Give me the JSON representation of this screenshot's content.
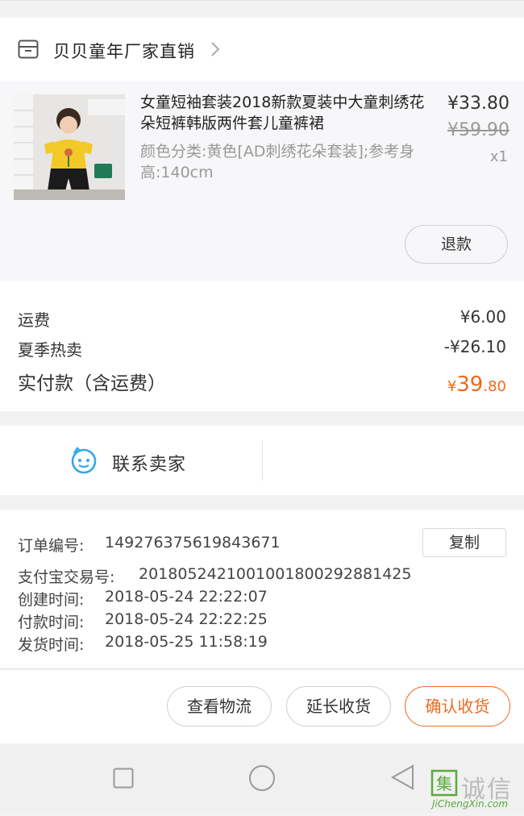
{
  "shop": {
    "name": "贝贝童年厂家直销"
  },
  "item": {
    "title": "女童短袖套装2018新款夏装中大童刺绣花朵短裤韩版两件套儿童裤裙",
    "sku": "颜色分类:黄色[AD刺绣花朵套装];参考身高:140cm",
    "price": "¥33.80",
    "original_price": "¥59.90",
    "quantity": "x1",
    "refund_label": "退款"
  },
  "fees": {
    "shipping_label": "运费",
    "shipping_value": "¥6.00",
    "promo_label": "夏季热卖",
    "promo_value": "-¥26.10",
    "total_label": "实付款（含运费）",
    "total_currency": "¥",
    "total_int": "39",
    "total_dec": ".80"
  },
  "contact": {
    "label": "联系卖家"
  },
  "order_info": {
    "order_no_label": "订单编号:",
    "order_no": "149276375619843671",
    "copy_label": "复制",
    "alipay_label": "支付宝交易号:",
    "alipay_no": "2018052421001001800292881425",
    "created_label": "创建时间:",
    "created": "2018-05-24 22:22:07",
    "paid_label": "付款时间:",
    "paid": "2018-05-24 22:22:25",
    "shipped_label": "发货时间:",
    "shipped": "2018-05-25 11:58:19"
  },
  "actions": {
    "logistics": "查看物流",
    "extend": "延长收货",
    "confirm": "确认收货"
  },
  "watermark": {
    "brand": "诚信",
    "url": "JiChengXin.com"
  },
  "colors": {
    "accent": "#ee6a20",
    "contact_icon": "#34a8e6"
  },
  "icons": [
    "shop-icon",
    "chevron-right-icon",
    "chat-face-icon",
    "nav-recent-icon",
    "nav-home-icon",
    "nav-back-icon"
  ]
}
